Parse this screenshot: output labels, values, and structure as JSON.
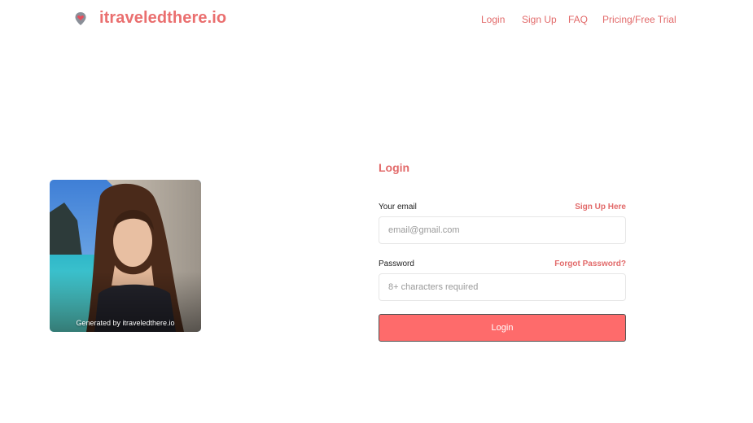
{
  "brand": {
    "name": "itraveledthere.io",
    "logo_icon": "pin-heart-logo-icon",
    "color": "#ea6f6f"
  },
  "nav": {
    "items": [
      "Login",
      "Sign Up",
      "FAQ",
      "Pricing/Free Trial"
    ]
  },
  "photo": {
    "caption": "Generated by itraveledthere.io"
  },
  "login": {
    "title": "Login",
    "email_label": "Your email",
    "signup_link": "Sign Up Here",
    "email_placeholder": "email@gmail.com",
    "email_value": "",
    "password_label": "Password",
    "forgot_link": "Forgot Password?",
    "password_placeholder": "8+ characters required",
    "password_value": "",
    "submit_label": "Login"
  },
  "colors": {
    "accent": "#e26a6a",
    "button": "#fe6b6b",
    "background": "#ffffff"
  }
}
